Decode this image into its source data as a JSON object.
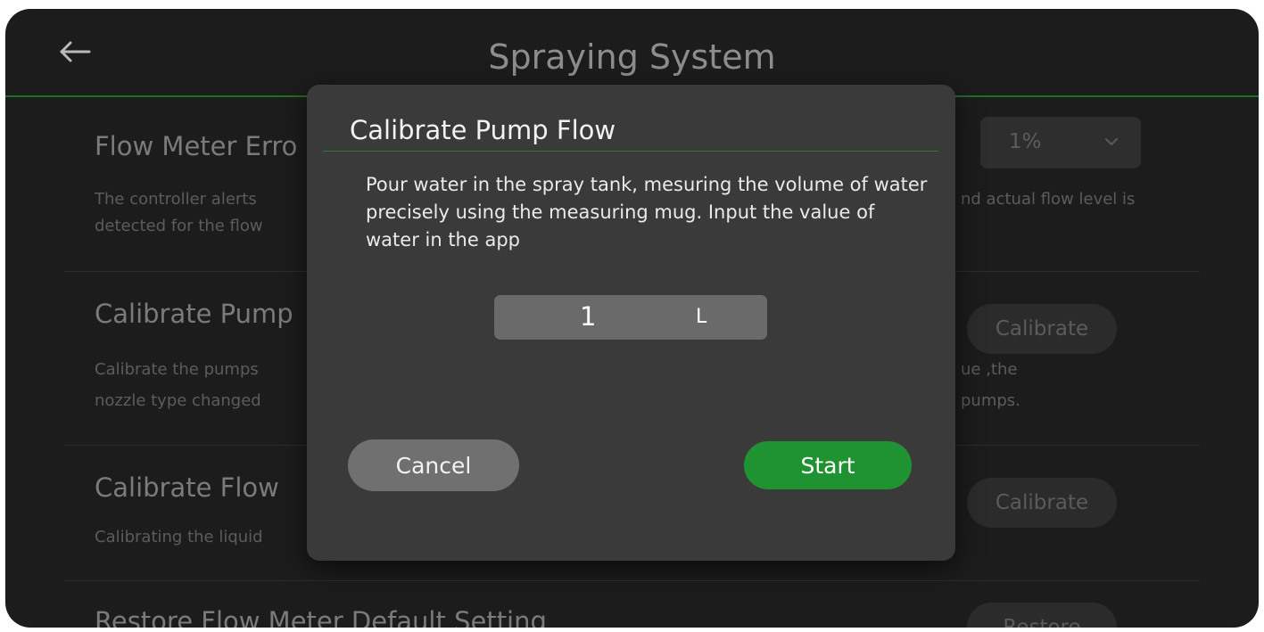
{
  "header": {
    "title": "Spraying System",
    "back_icon": "arrow-left-icon"
  },
  "sections": {
    "flow_meter_error": {
      "title": "Flow Meter Erro",
      "desc_line1": "The controller alerts",
      "desc_line2": "detected for the flow",
      "desc_right_line1": "nd actual flow level is",
      "select_value": "1%",
      "select_icon": "chevron-down-icon"
    },
    "calibrate_pump": {
      "title": "Calibrate Pump",
      "desc_line1": "Calibrate the pumps",
      "desc_line2": "nozzle type changed",
      "desc_right_line1": "ue ,the",
      "desc_right_line2": "pumps.",
      "button_label": "Calibrate"
    },
    "calibrate_flow": {
      "title": "Calibrate Flow",
      "desc_line1": "Calibrating the liquid",
      "button_label": "Calibrate"
    },
    "restore": {
      "title": "Restore Flow Meter Default Setting",
      "button_label": "Restore"
    }
  },
  "dialog": {
    "title": "Calibrate Pump Flow",
    "message": "Pour water in the spray tank, mesuring the volume of water precisely using the measuring mug. Input the value of water in the app",
    "quantity_value": "1",
    "quantity_unit": "L",
    "cancel_label": "Cancel",
    "start_label": "Start"
  },
  "colors": {
    "accent_green": "#1f9331",
    "divider_green": "#2a7d35",
    "dialog_bg": "#3a3a3a",
    "screen_bg": "#1c1c1c"
  }
}
